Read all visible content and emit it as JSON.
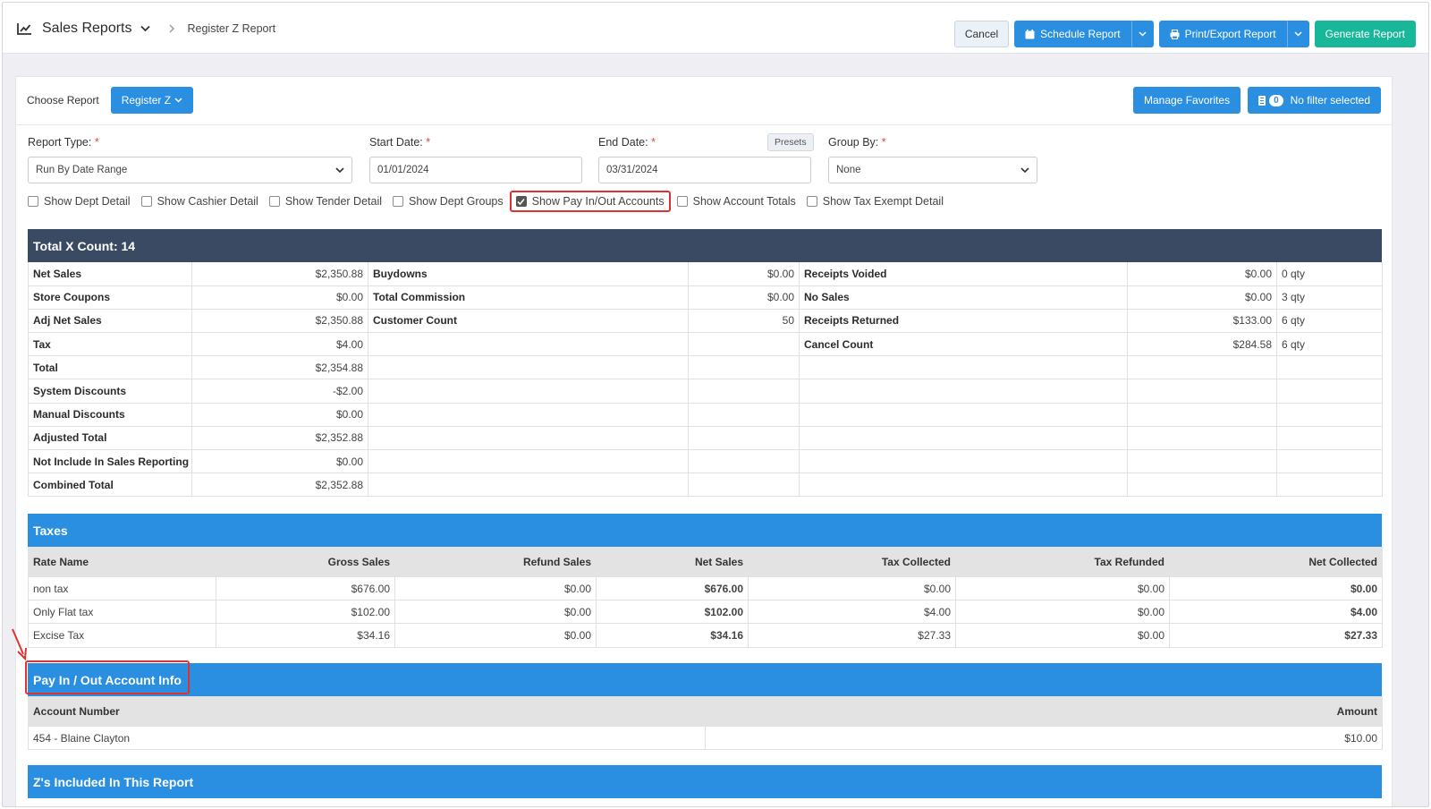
{
  "header": {
    "title": "Sales Reports",
    "breadcrumb": "Register Z Report",
    "cancel": "Cancel",
    "schedule": "Schedule Report",
    "print_export": "Print/Export Report",
    "generate": "Generate Report"
  },
  "choose": {
    "label": "Choose Report",
    "report": "Register Z",
    "manage_favorites": "Manage Favorites",
    "filter_count": "0",
    "filter_text": "No filter selected"
  },
  "form": {
    "report_type_label": "Report Type:",
    "report_type_value": "Run By Date Range",
    "start_date_label": "Start Date:",
    "start_date_value": "01/01/2024",
    "end_date_label": "End Date:",
    "end_date_value": "03/31/2024",
    "presets": "Presets",
    "group_by_label": "Group By:",
    "group_by_value": "None",
    "required_mark": "*"
  },
  "checkboxes": [
    {
      "label": "Show Dept Detail",
      "checked": false
    },
    {
      "label": "Show Cashier Detail",
      "checked": false
    },
    {
      "label": "Show Tender Detail",
      "checked": false
    },
    {
      "label": "Show Dept Groups",
      "checked": false
    },
    {
      "label": "Show Pay In/Out Accounts",
      "checked": true
    },
    {
      "label": "Show Account Totals",
      "checked": false
    },
    {
      "label": "Show Tax Exempt Detail",
      "checked": false
    }
  ],
  "xcount": {
    "title": "Total X Count: 14",
    "rows": [
      [
        "Net Sales",
        "$2,350.88",
        "Buydowns",
        "$0.00",
        "Receipts Voided",
        "$0.00",
        "0 qty"
      ],
      [
        "Store Coupons",
        "$0.00",
        "Total Commission",
        "$0.00",
        "No Sales",
        "$0.00",
        "3 qty"
      ],
      [
        "Adj Net Sales",
        "$2,350.88",
        "Customer Count",
        "50",
        "Receipts Returned",
        "$133.00",
        "6 qty"
      ],
      [
        "Tax",
        "$4.00",
        "",
        "",
        "Cancel Count",
        "$284.58",
        "6 qty"
      ],
      [
        "Total",
        "$2,354.88",
        "",
        "",
        "",
        "",
        ""
      ],
      [
        "System Discounts",
        "-$2.00",
        "",
        "",
        "",
        "",
        ""
      ],
      [
        "Manual Discounts",
        "$0.00",
        "",
        "",
        "",
        "",
        ""
      ],
      [
        "Adjusted Total",
        "$2,352.88",
        "",
        "",
        "",
        "",
        ""
      ],
      [
        "Not Include In Sales Reporting",
        "$0.00",
        "",
        "",
        "",
        "",
        ""
      ],
      [
        "Combined Total",
        "$2,352.88",
        "",
        "",
        "",
        "",
        ""
      ]
    ]
  },
  "taxes": {
    "title": "Taxes",
    "columns": [
      "Rate Name",
      "Gross Sales",
      "Refund Sales",
      "Net Sales",
      "Tax Collected",
      "Tax Refunded",
      "Net Collected"
    ],
    "rows": [
      [
        "non tax",
        "$676.00",
        "$0.00",
        "$676.00",
        "$0.00",
        "$0.00",
        "$0.00"
      ],
      [
        "Only Flat tax",
        "$102.00",
        "$0.00",
        "$102.00",
        "$4.00",
        "$0.00",
        "$4.00"
      ],
      [
        "Excise Tax",
        "$34.16",
        "$0.00",
        "$34.16",
        "$27.33",
        "$0.00",
        "$27.33"
      ]
    ]
  },
  "payinout": {
    "title": "Pay In / Out Account Info",
    "columns": [
      "Account Number",
      "Amount"
    ],
    "rows": [
      [
        "454 - Blaine Clayton",
        "$10.00"
      ]
    ]
  },
  "zs": {
    "title": "Z's Included In This Report"
  },
  "colors": {
    "primary_blue": "#2a8fe0",
    "green": "#18b79a",
    "dark_header": "#3b4a63",
    "highlight_red": "#e03131"
  }
}
